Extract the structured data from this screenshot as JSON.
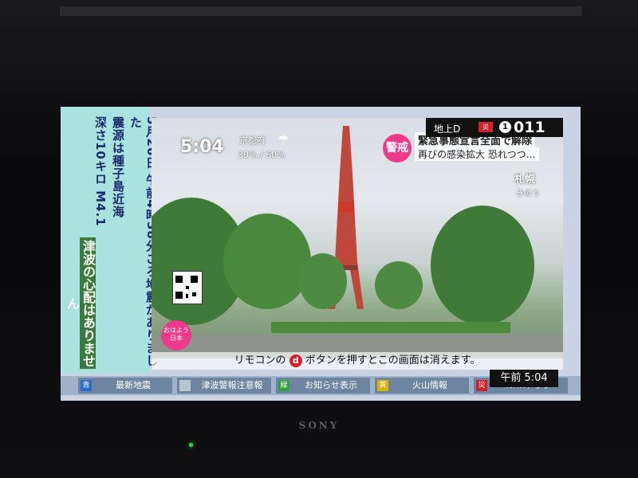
{
  "left_panel": {
    "quake_lines": [
      "5月26日 午前4時38分ごろ地震がありました",
      "震源は種子島近海",
      "深さ10キロ M4.1"
    ],
    "tsunami": "津波の心配はありません"
  },
  "video": {
    "clock": "5:04",
    "weather_city": "京都府",
    "weather_pct": "30% / 60%",
    "news_badge": "警戒",
    "news_headline": "緊急事態宣言全面で解除",
    "news_sub": "再びの感染拡大 恐れつつ…",
    "location": "札幌",
    "location_sub": "きのう",
    "ohayo": "おはよう日本"
  },
  "channel": {
    "label": "地上D",
    "red_box": "災",
    "circle": "1",
    "number": "011"
  },
  "remote_msg": {
    "pre": "リモコンの",
    "d": "d",
    "post": "ボタンを押すとこの画面は消えます。"
  },
  "time_box": "午前 5:04",
  "buttons": [
    {
      "key": "青",
      "label": "最新地震",
      "color": "#2a6fd0"
    },
    {
      "key": "",
      "label": "津波警報注意報",
      "color": "#b8c4d0"
    },
    {
      "key": "緑",
      "label": "お知らせ表示",
      "color": "#30a040"
    },
    {
      "key": "黄",
      "label": "火山情報",
      "color": "#e0b000"
    },
    {
      "key": "災",
      "label": "NHKトップ",
      "color": "#d0202a"
    }
  ],
  "brand": "SONY"
}
